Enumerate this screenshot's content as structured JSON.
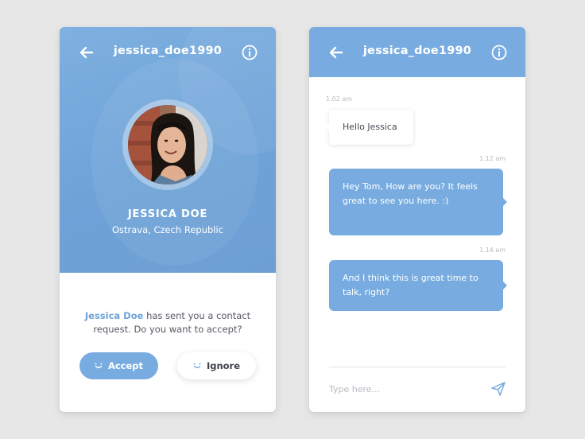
{
  "colors": {
    "accent": "#78ace0",
    "background": "#e7e7e7",
    "card": "#ffffff",
    "text_dark": "#3d4148",
    "text_muted": "#b5b9bf"
  },
  "profile_screen": {
    "header": {
      "back_icon": "arrow-left-icon",
      "username": "jessica_doe1990",
      "info_icon": "info-circle-icon"
    },
    "profile": {
      "name": "JESSICA DOE",
      "location": "Ostrava, Czech Republic"
    },
    "request": {
      "sender": "Jessica Doe",
      "message": " has sent you a contact request. Do you want to accept?"
    },
    "actions": {
      "accept_label": "Accept",
      "accept_icon": "smile-icon",
      "ignore_label": "Ignore",
      "ignore_icon": "wink-icon"
    }
  },
  "chat_screen": {
    "header": {
      "back_icon": "arrow-left-icon",
      "username": "jessica_doe1990",
      "info_icon": "info-circle-icon"
    },
    "messages": [
      {
        "time": "1.02 am",
        "text": "Hello Jessica",
        "direction": "received"
      },
      {
        "time": "1.12 am",
        "text": "Hey Tom, How are you? It feels great to see you here. :)",
        "direction": "sent"
      },
      {
        "time": "1.14 am",
        "text": "And I think this is great time to talk, right?",
        "direction": "sent"
      }
    ],
    "composer": {
      "placeholder": "Type here...",
      "send_icon": "paper-plane-icon"
    }
  }
}
